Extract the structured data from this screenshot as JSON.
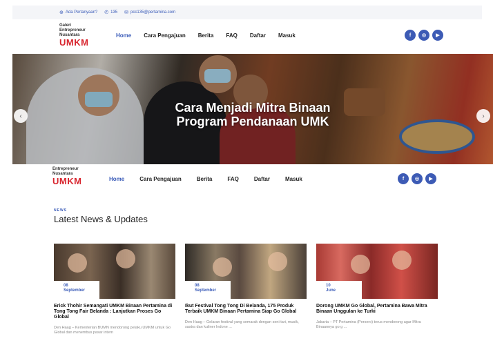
{
  "topbar": {
    "question": "Ada Pertanyaan?",
    "phone": "135",
    "email": "pcc135@pertamina.com"
  },
  "logo": {
    "line1": "Galeri",
    "line2": "Entrepreneur",
    "line3": "Nusantara",
    "brand": "UMKM"
  },
  "logo2": {
    "line1": "Entrepreneur",
    "line2": "Nusantara",
    "brand": "UMKM"
  },
  "menu": [
    "Home",
    "Cara Pengajuan",
    "Berita",
    "FAQ",
    "Daftar",
    "Masuk"
  ],
  "socials": [
    {
      "icon": "facebook-icon",
      "glyph": "f"
    },
    {
      "icon": "instagram-icon",
      "glyph": "◎"
    },
    {
      "icon": "youtube-icon",
      "glyph": "▶"
    }
  ],
  "hero": {
    "line1": "Cara Menjadi Mitra Binaan",
    "line2": "Program Pendanaan UMK",
    "prev": "‹",
    "next": "›"
  },
  "news": {
    "kicker": "NEWS",
    "title": "Latest News & Updates",
    "cards": [
      {
        "day": "08",
        "month": "September",
        "title": "Erick Thohir Semangati UMKM Binaan Pertamina di Tong Tong Fair Belanda : Lanjutkan Proses Go Global",
        "excerpt": "Den Haag – Kementerian BUMN mendorong pelaku UMKM untuk Go Global dan menembus pasar intern"
      },
      {
        "day": "08",
        "month": "September",
        "title": "Ikut Festival Tong Tong Di Belanda, 175 Produk Terbaik UMKM Binaan Pertamina Siap Go Global",
        "excerpt": "Den Haag – Gelaran festival yang semarak dengan seni tari, musik, sastra dan kuliner Indone ..."
      },
      {
        "day": "10",
        "month": "June",
        "title": "Dorong UMKM Go Global, Pertamina Bawa Mitra Binaan Unggulan ke Turki",
        "excerpt": "Jakarta – PT Pertamina (Persero) terus mendorong agar Mitra Binaannya go g ..."
      }
    ]
  }
}
